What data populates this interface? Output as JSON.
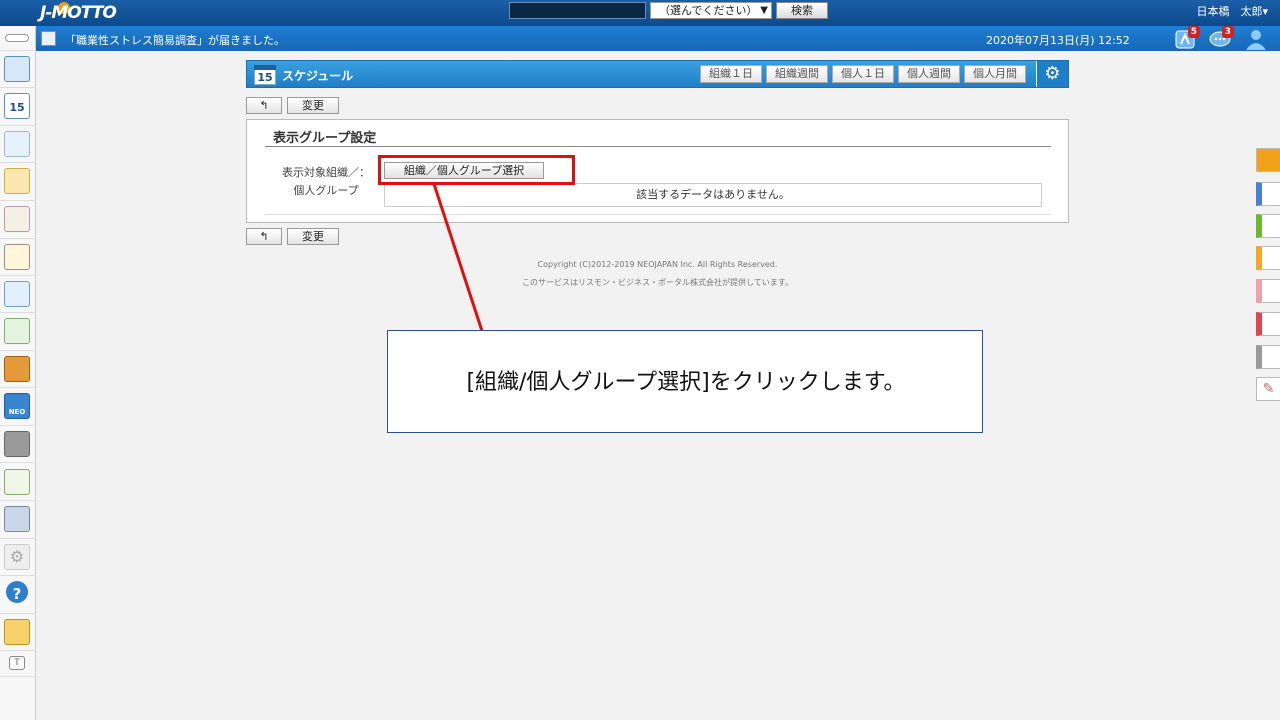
{
  "header": {
    "logo_text": "J-MOTTO",
    "search_placeholder": "",
    "scope_select_value": "（選んでください）",
    "search_button": "検索",
    "user_name": "日本橋　太郎▾"
  },
  "notification": {
    "message": "「職業性ストレス簡易調査」が届きました。",
    "datetime": "2020年07月13日(月) 12:52",
    "alerts_badge": "5",
    "messages_badge": "3"
  },
  "app": {
    "icon_day": "15",
    "title": "スケジュール",
    "view_tabs": [
      "組織１日",
      "組織週間",
      "個人１日",
      "個人週間",
      "個人月間"
    ],
    "settings_icon": "⚙"
  },
  "toolbar": {
    "back_label": "↰",
    "change_label": "変更"
  },
  "panel": {
    "title": "表示グループ設定",
    "field_label_line1": "表示対象組織／：",
    "field_label_line2": "個人グループ",
    "group_select_button": "組織／個人グループ選択",
    "no_data": "該当するデータはありません。"
  },
  "footer": {
    "copyright": "Copyright (C)2012-2019 NEOJAPAN Inc. All Rights Reserved.",
    "provider": "このサービスはリスモン・ビジネス・ポータル株式会社が提供しています。"
  },
  "annotation": {
    "callout_text": "[組織/個人グループ選択]をクリックします。",
    "highlight_color": "#e01010"
  },
  "sidebar_icons": [
    "portal-icon",
    "schedule-icon",
    "facility-icon",
    "memo-icon",
    "bulletin-icon",
    "report-icon",
    "search-doc-icon",
    "workflow-icon",
    "cabinet-icon",
    "neo-icon",
    "folder-icon",
    "eco-icon",
    "photo-icon",
    "settings-icon",
    "help-icon",
    "support-icon",
    "text-icon"
  ],
  "right_tab_colors": [
    "#f3a21a",
    "#4a7fd6",
    "#6ab82e",
    "#f5a623",
    "#f4a0a8",
    "#e0454e",
    "#999999",
    "#ffffff"
  ]
}
